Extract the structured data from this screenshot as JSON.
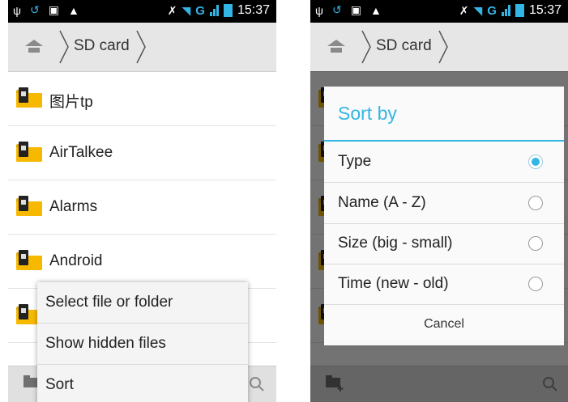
{
  "status": {
    "time": "15:37",
    "network": "G"
  },
  "path": {
    "crumb": "SD card"
  },
  "left": {
    "files": [
      "图片tp",
      "AirTalkee",
      "Alarms",
      "Android"
    ],
    "menu": [
      "Select file or folder",
      "Show hidden files",
      "Sort"
    ]
  },
  "right": {
    "dialog": {
      "title": "Sort by",
      "options": [
        {
          "label": "Type",
          "selected": true
        },
        {
          "label": "Name (A - Z)",
          "selected": false
        },
        {
          "label": "Size (big - small)",
          "selected": false
        },
        {
          "label": "Time (new - old)",
          "selected": false
        }
      ],
      "cancel": "Cancel"
    },
    "peek_row": "360"
  },
  "colors": {
    "accent": "#33b5e5",
    "folder": "#f7b900"
  },
  "icons": [
    "usb-icon",
    "sync-icon",
    "image-icon",
    "warning-icon",
    "mute-icon",
    "wifi-icon",
    "signal-icon",
    "battery-icon",
    "home-icon",
    "new-folder-icon",
    "search-icon"
  ]
}
